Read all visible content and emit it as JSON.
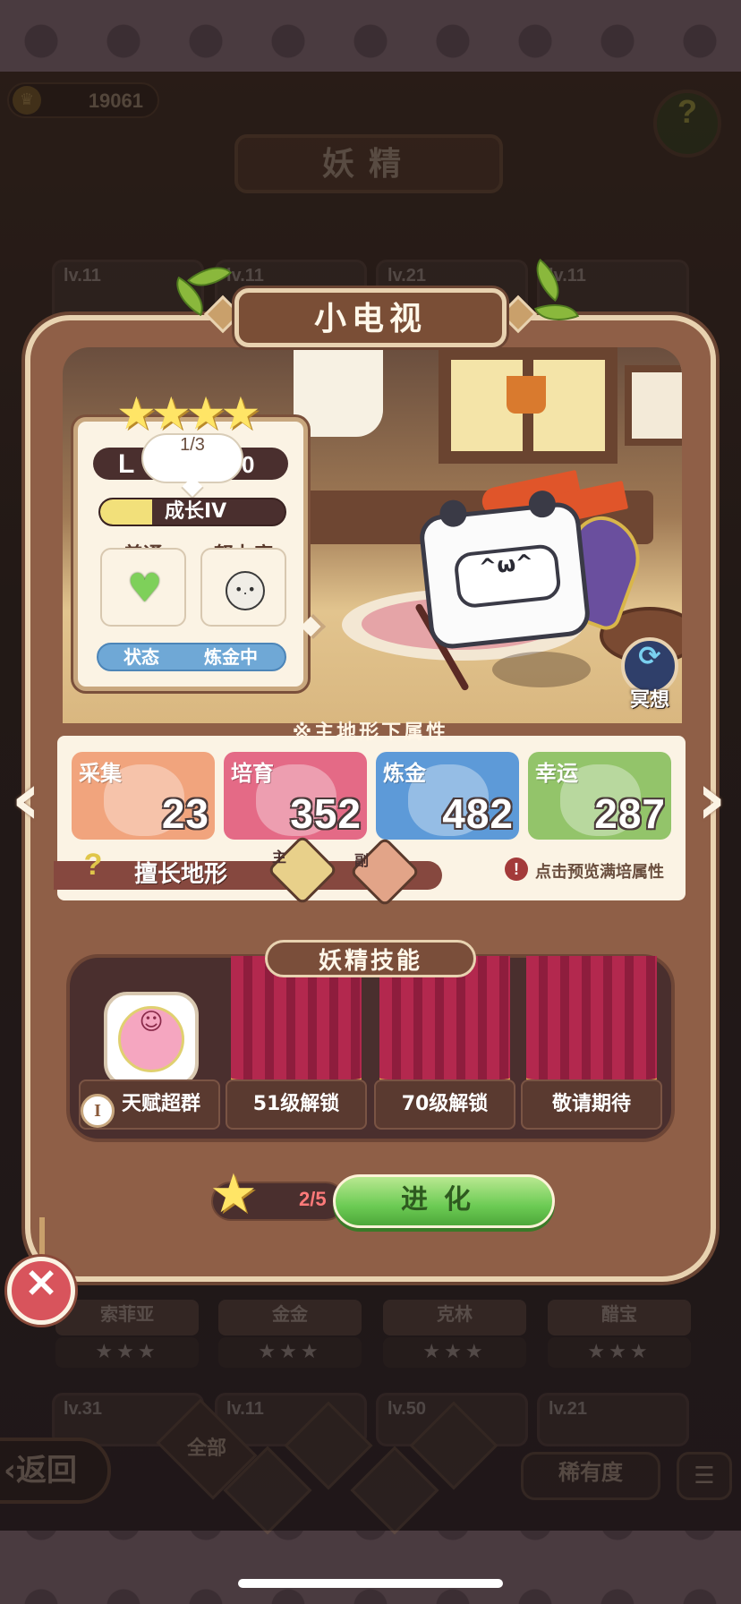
{
  "header": {
    "coins": "19061",
    "title": "妖精"
  },
  "background_cards": [
    {
      "level": "lv.11"
    },
    {
      "level": "lv.11"
    },
    {
      "level": "lv.21"
    },
    {
      "level": "lv.11"
    }
  ],
  "background_cards_row2": [
    {
      "name": "索菲亚",
      "stars": "★★★"
    },
    {
      "name": "金金",
      "stars": "★★★"
    },
    {
      "name": "克林",
      "stars": "★★★"
    },
    {
      "name": "醋宝",
      "stars": "★★★"
    }
  ],
  "background_cards_row3": [
    {
      "level": "lv.31"
    },
    {
      "level": "lv.11"
    },
    {
      "level": "lv.50"
    },
    {
      "level": "lv.21"
    }
  ],
  "bottom_bar": {
    "back_label": "返回",
    "filter_all": "全部",
    "rarity": "稀有度",
    "sort_icon": "☰"
  },
  "fairy": {
    "name": "小电视",
    "stars": "★★★★",
    "level_prefix": "L",
    "level_suffix": "0",
    "bubble": "1/3",
    "growth_label": "成长IV",
    "growth_progress": 0.28,
    "trait1_label": "普通",
    "trait2_label": "努力度",
    "heart_icon": "♥",
    "face_icon": "•.•",
    "status_key": "状态",
    "status_value": "炼金中",
    "meditate_label": "冥想",
    "meditate_icon": "⟳"
  },
  "attributes": {
    "title": "※主地形下属性",
    "items": [
      {
        "name": "采集",
        "value": "23",
        "color": "#f1a47d"
      },
      {
        "name": "培育",
        "value": "352",
        "color": "#e46a86"
      },
      {
        "name": "炼金",
        "value": "482",
        "color": "#5d9ad8"
      },
      {
        "name": "幸运",
        "value": "287",
        "color": "#93c46a"
      }
    ],
    "terrain_label": "擅长地形",
    "terrain_main_tag": "主",
    "terrain_sub_tag": "副",
    "preview_text": "点击预览满培属性",
    "preview_icon": "!",
    "left_arrow": "‹",
    "right_arrow": "›"
  },
  "skills": {
    "title": "妖精技能",
    "talent_badge": "I",
    "talent_icon": "☺",
    "slots": [
      {
        "label": "天赋超群"
      },
      {
        "label": "51级解锁"
      },
      {
        "label": "70级解锁"
      },
      {
        "label": "敬请期待"
      }
    ]
  },
  "evolve": {
    "count": "2/5",
    "label": "进化",
    "star_icon": "★"
  },
  "close_icon": "✕",
  "help_icon": "?",
  "coin_icon": "♛"
}
